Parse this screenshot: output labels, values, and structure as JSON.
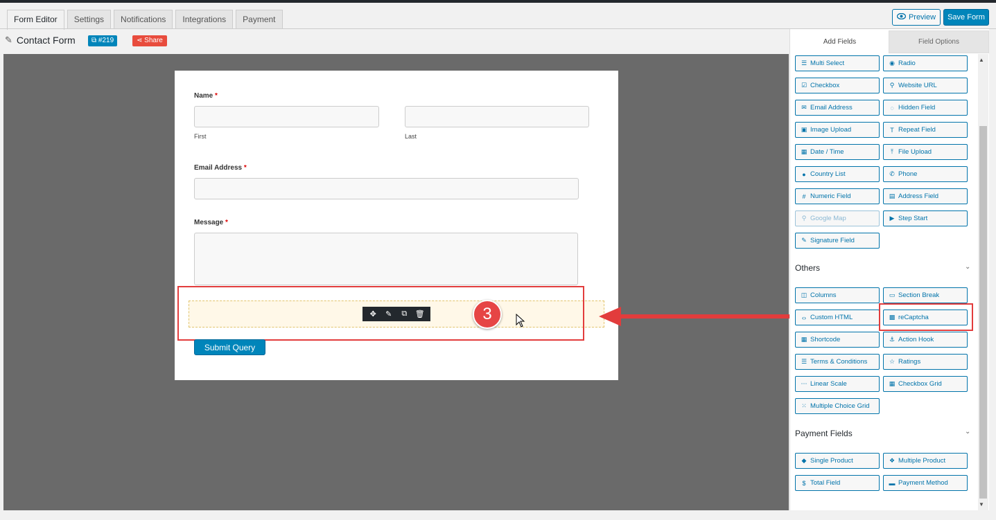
{
  "tabs": [
    "Form Editor",
    "Settings",
    "Notifications",
    "Integrations",
    "Payment"
  ],
  "header": {
    "preview_label": "Preview",
    "save_label": "Save Form"
  },
  "form": {
    "title": "Contact Form",
    "id_badge": "#219",
    "share_label": "Share",
    "name_label": "Name",
    "first_label": "First",
    "last_label": "Last",
    "email_label": "Email Address",
    "message_label": "Message",
    "required_mark": "*",
    "submit_label": "Submit Query",
    "step_number": "3"
  },
  "panel": {
    "tab_add": "Add Fields",
    "tab_options": "Field Options",
    "general_fields": [
      {
        "label": "Multi Select",
        "icon": "list-icon"
      },
      {
        "label": "Radio",
        "icon": "radio-icon"
      },
      {
        "label": "Checkbox",
        "icon": "checkbox-icon"
      },
      {
        "label": "Website URL",
        "icon": "link-icon"
      },
      {
        "label": "Email Address",
        "icon": "envelope-icon"
      },
      {
        "label": "Hidden Field",
        "icon": "eye-slash-icon"
      },
      {
        "label": "Image Upload",
        "icon": "image-icon"
      },
      {
        "label": "Repeat Field",
        "icon": "text-icon"
      },
      {
        "label": "Date / Time",
        "icon": "calendar-icon"
      },
      {
        "label": "File Upload",
        "icon": "upload-icon"
      },
      {
        "label": "Country List",
        "icon": "globe-icon"
      },
      {
        "label": "Phone",
        "icon": "phone-icon"
      },
      {
        "label": "Numeric Field",
        "icon": "hash-icon"
      },
      {
        "label": "Address Field",
        "icon": "address-card-icon"
      },
      {
        "label": "Google Map",
        "icon": "map-marker-icon"
      },
      {
        "label": "Step Start",
        "icon": "step-icon"
      },
      {
        "label": "Signature Field",
        "icon": "signature-icon"
      }
    ],
    "others_title": "Others",
    "other_fields": [
      {
        "label": "Columns",
        "icon": "columns-icon"
      },
      {
        "label": "Section Break",
        "icon": "section-icon"
      },
      {
        "label": "Custom HTML",
        "icon": "code-icon"
      },
      {
        "label": "reCaptcha",
        "icon": "qrcode-icon"
      },
      {
        "label": "Shortcode",
        "icon": "calendar-icon"
      },
      {
        "label": "Action Hook",
        "icon": "anchor-icon"
      },
      {
        "label": "Terms & Conditions",
        "icon": "list-icon"
      },
      {
        "label": "Ratings",
        "icon": "star-icon"
      },
      {
        "label": "Linear Scale",
        "icon": "dots-icon"
      },
      {
        "label": "Checkbox Grid",
        "icon": "grid-icon"
      },
      {
        "label": "Multiple Choice Grid",
        "icon": "dotgrid-icon"
      }
    ],
    "payment_title": "Payment Fields",
    "payment_fields": [
      {
        "label": "Single Product",
        "icon": "cube-icon"
      },
      {
        "label": "Multiple Product",
        "icon": "cubes-icon"
      },
      {
        "label": "Total Field",
        "icon": "dollar-icon"
      },
      {
        "label": "Payment Method",
        "icon": "credit-card-icon"
      }
    ]
  },
  "colors": {
    "accent": "#0073aa",
    "save": "#0085ba",
    "share": "#e84c3d",
    "highlight": "#e23c3c"
  }
}
